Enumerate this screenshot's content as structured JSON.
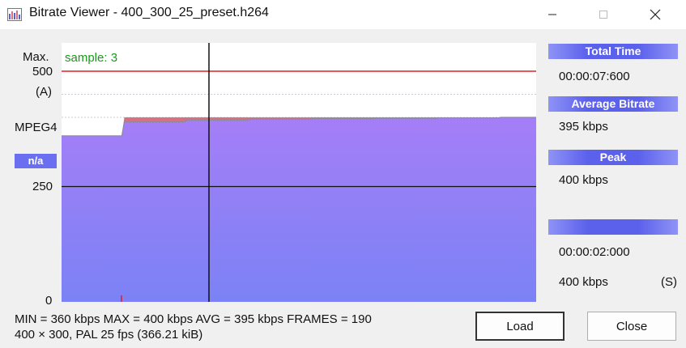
{
  "window": {
    "title": "Bitrate Viewer - 400_300_25_preset.h264"
  },
  "chart": {
    "sample_label": "sample: 3",
    "y_labels": {
      "max": "Max.",
      "top": "500",
      "top_suffix": "(A)",
      "codec": "MPEG4",
      "mid": "250",
      "zero": "0"
    },
    "na_badge": "n/a"
  },
  "chart_data": {
    "type": "area",
    "title": "",
    "ylim": [
      0,
      550
    ],
    "max_line": 500,
    "avg": 395,
    "cursor_sample": 3,
    "x_range": [
      1,
      190
    ],
    "x": [
      1,
      25,
      26,
      50,
      51,
      75,
      76,
      100,
      101,
      125,
      126,
      150,
      151,
      175,
      176,
      190
    ],
    "bitrate": [
      360,
      360,
      390,
      390,
      394,
      394,
      396,
      396,
      397,
      397,
      398,
      398,
      399,
      399,
      400,
      400
    ],
    "peak_series": [
      360,
      360,
      400,
      400,
      400,
      400,
      400,
      400,
      400,
      400,
      400,
      400,
      400,
      400,
      400,
      400
    ],
    "colors": {
      "area": "#8e83f6",
      "peak": "#d9707f",
      "max_line": "#e02020",
      "cursor": "#111111"
    }
  },
  "panel": {
    "total_time_label": "Total Time",
    "total_time": "00:00:07:600",
    "avg_bitrate_label": "Average Bitrate",
    "avg_bitrate": "395 kbps",
    "peak_label": "Peak",
    "peak": "400 kbps",
    "blank_label": "",
    "cursor_time": "00:00:02:000",
    "cursor_bitrate": "400 kbps",
    "cursor_suffix": "(S)"
  },
  "stats": {
    "line1": "MIN = 360 kbps  MAX = 400 kbps  AVG = 395 kbps  FRAMES = 190",
    "line2": "400 × 300, PAL 25 fps    (366.21 kiB)"
  },
  "buttons": {
    "load": "Load",
    "close": "Close"
  }
}
